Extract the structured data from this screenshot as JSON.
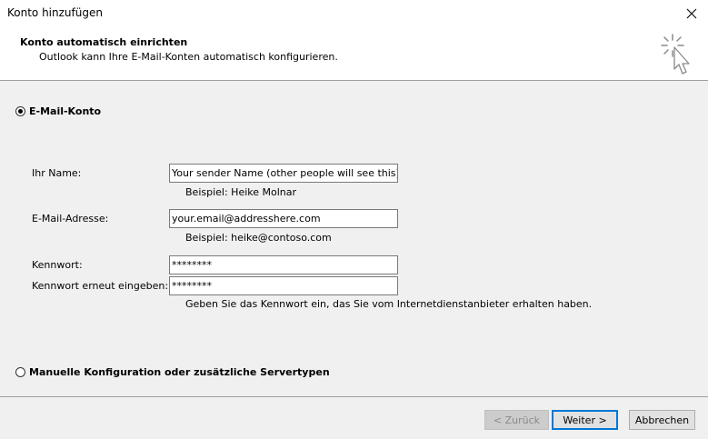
{
  "window": {
    "title": "Konto hinzufügen"
  },
  "header": {
    "title": "Konto automatisch einrichten",
    "subtitle": "Outlook kann Ihre E-Mail-Konten automatisch konfigurieren."
  },
  "options": {
    "email_account": {
      "label": "E-Mail-Konto",
      "selected": true
    },
    "manual_config": {
      "label": "Manuelle Konfiguration oder zusätzliche Servertypen",
      "selected": false
    }
  },
  "form": {
    "name": {
      "label": "Ihr Name:",
      "value": "Your sender Name (other people will see this)",
      "hint": "Beispiel: Heike Molnar"
    },
    "email": {
      "label": "E-Mail-Adresse:",
      "value": "your.email@addresshere.com",
      "hint": "Beispiel: heike@contoso.com"
    },
    "password": {
      "label": "Kennwort:",
      "value": "********"
    },
    "password_confirm": {
      "label": "Kennwort erneut eingeben:",
      "value": "********",
      "hint": "Geben Sie das Kennwort ein, das Sie vom Internetdienstanbieter erhalten haben."
    }
  },
  "buttons": {
    "back": "< Zurück",
    "next": "Weiter >",
    "cancel": "Abbrechen"
  },
  "icons": {
    "close": "close-icon",
    "wizard": "wizard-cursor-icon"
  }
}
